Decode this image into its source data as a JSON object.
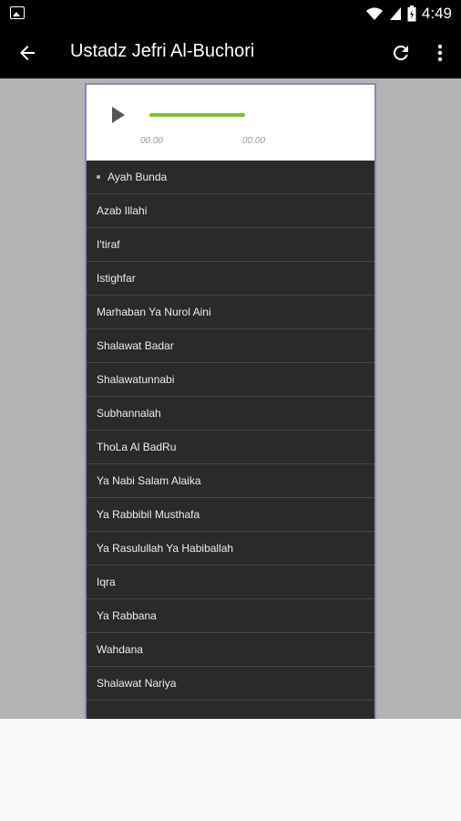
{
  "status_bar": {
    "time": "4:49",
    "left_icon": "image-icon",
    "icons": [
      "wifi-icon",
      "signal-icon",
      "battery-icon"
    ]
  },
  "app_bar": {
    "title": "Ustadz Jefri Al-Buchori",
    "back_icon": "arrow-left-icon",
    "refresh_icon": "refresh-icon",
    "more_icon": "more-vertical-icon"
  },
  "player": {
    "current_time": "00.00",
    "duration": "00.00",
    "progress": 1.0,
    "progress_color": "#7fc222"
  },
  "tracks": [
    {
      "label": "Ayah Bunda",
      "active": true
    },
    {
      "label": "Azab Illahi"
    },
    {
      "label": "I'tiraf"
    },
    {
      "label": "Istighfar"
    },
    {
      "label": "Marhaban Ya Nurol Aini"
    },
    {
      "label": "Shalawat Badar"
    },
    {
      "label": "Shalawatunnabi"
    },
    {
      "label": "Subhannalah"
    },
    {
      "label": "ThoLa Al BadRu"
    },
    {
      "label": "Ya Nabi Salam Alaika"
    },
    {
      "label": "Ya Rabbibil Musthafa"
    },
    {
      "label": "Ya Rasulullah Ya Habiballah"
    },
    {
      "label": "Iqra"
    },
    {
      "label": "Ya Rabbana"
    },
    {
      "label": "Wahdana"
    },
    {
      "label": "Shalawat Nariya"
    }
  ]
}
